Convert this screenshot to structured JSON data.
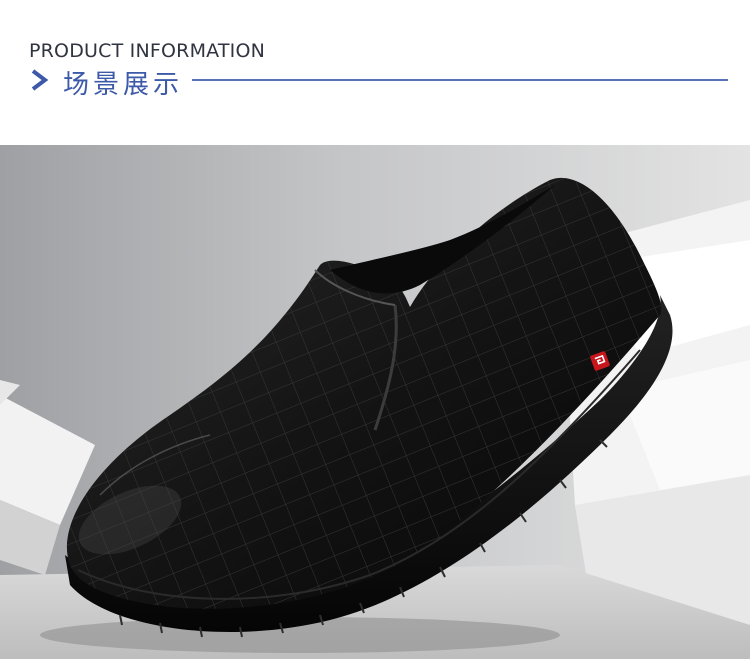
{
  "header": {
    "title_en": "PRODUCT INFORMATION",
    "title_cn": "场景展示",
    "accent_color": "#3d5aa8",
    "chevron_icon": "chevron-right-icon"
  },
  "photo": {
    "subject": "black slip-on leather loafer",
    "badge_color": "#c8161d"
  }
}
